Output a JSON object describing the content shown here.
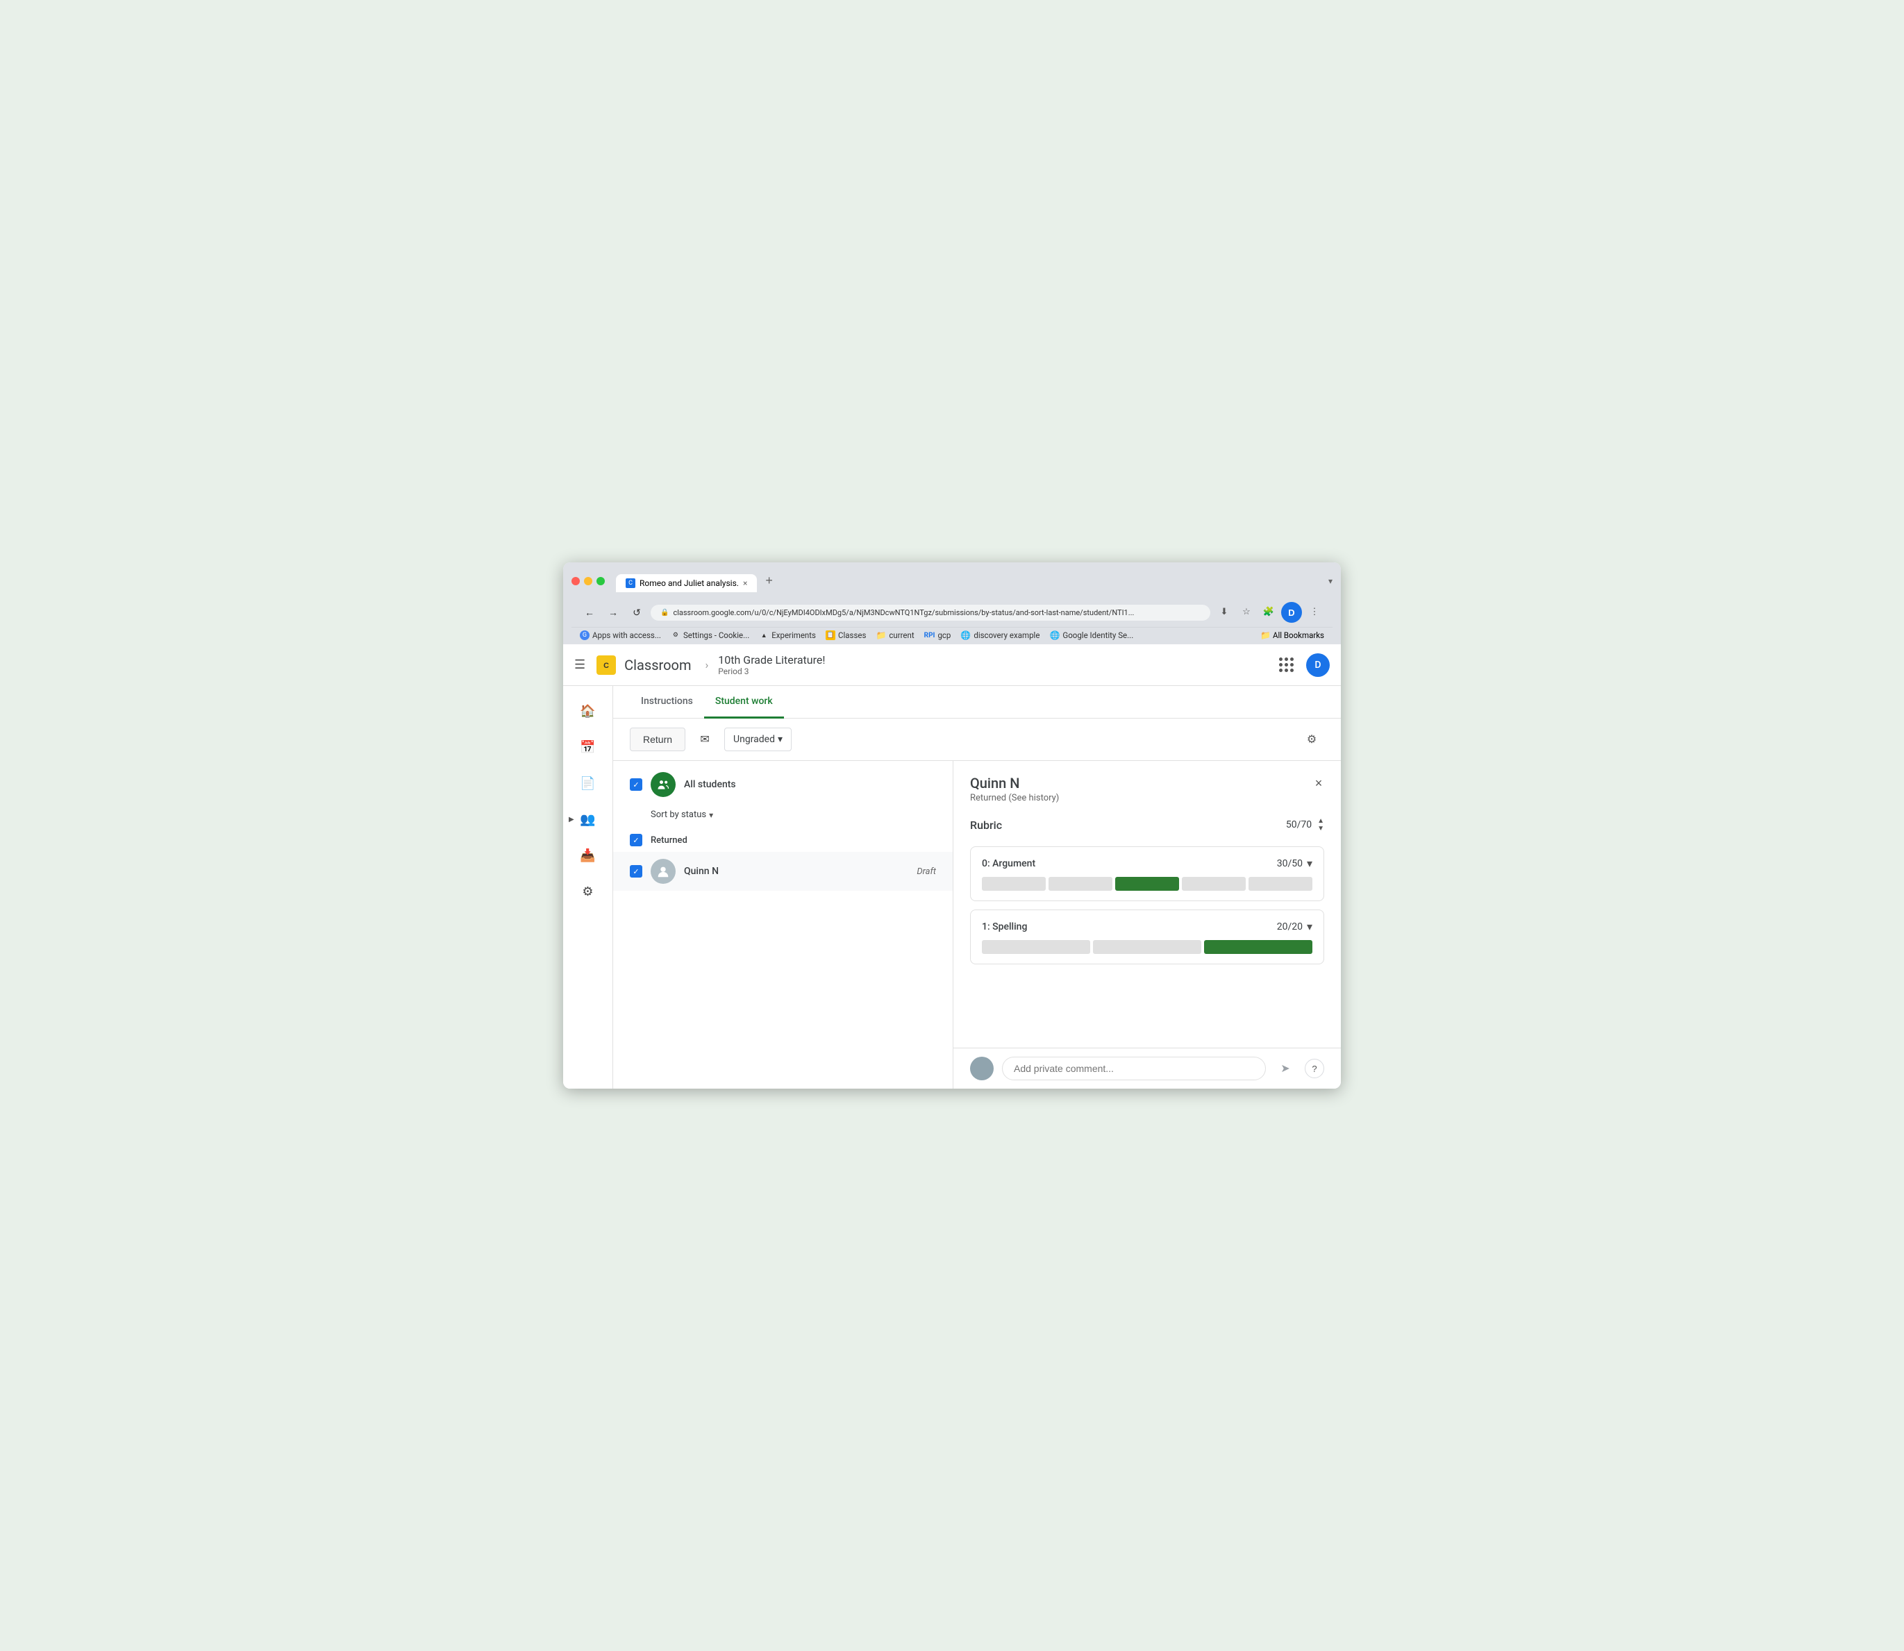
{
  "browser": {
    "tab_title": "Romeo and Juliet analysis.",
    "tab_close": "×",
    "new_tab": "+",
    "more_icon": "▾",
    "url": "classroom.google.com/u/0/c/NjEyMDI4ODIxMDg5/a/NjM3NDcwNTQ1NTgz/submissions/by-status/and-sort-last-name/student/NTI1...",
    "nav": {
      "back": "←",
      "forward": "→",
      "refresh": "↺"
    },
    "bookmarks": [
      {
        "label": "Apps with access...",
        "icon": "G",
        "icon_bg": "#4285f4"
      },
      {
        "label": "Settings - Cookie...",
        "icon": "⚙",
        "icon_bg": "#9e9e9e"
      },
      {
        "label": "Experiments",
        "icon": "▲",
        "icon_bg": "#333"
      },
      {
        "label": "Classes",
        "icon": "📋",
        "icon_bg": "#fbbc04"
      },
      {
        "label": "current",
        "icon": "📁",
        "icon_bg": "#9e9e9e"
      },
      {
        "label": "gcp",
        "icon": "RPI",
        "icon_bg": "#1a73e8"
      },
      {
        "label": "discovery example",
        "icon": "🌐",
        "icon_bg": "#34a853"
      },
      {
        "label": "Google Identity Se...",
        "icon": "G",
        "icon_bg": "#4285f4"
      }
    ],
    "bookmarks_folder": "All Bookmarks"
  },
  "app": {
    "menu_icon": "☰",
    "logo_text": "C",
    "name": "Classroom",
    "breadcrumb_sep": "›",
    "course": {
      "title": "10th Grade Literature!",
      "period": "Period 3"
    },
    "topbar_grid": "grid",
    "topbar_avatar": "D"
  },
  "sidebar": {
    "items": [
      {
        "name": "home",
        "icon": "⌂"
      },
      {
        "name": "calendar",
        "icon": "📅"
      },
      {
        "name": "assignments",
        "icon": "📄"
      },
      {
        "name": "people",
        "icon": "👥"
      },
      {
        "name": "archive",
        "icon": "📥"
      },
      {
        "name": "settings",
        "icon": "⚙"
      }
    ]
  },
  "tabs": [
    {
      "label": "Instructions",
      "active": false
    },
    {
      "label": "Student work",
      "active": true
    }
  ],
  "toolbar": {
    "return_label": "Return",
    "email_icon": "✉",
    "ungraded_label": "Ungraded",
    "dropdown_arrow": "▾",
    "gear_icon": "⚙"
  },
  "student_list": {
    "all_students_label": "All students",
    "sort_label": "Sort by status",
    "sort_arrow": "▾",
    "sections": [
      {
        "title": "Returned",
        "students": [
          {
            "name": "Quinn N",
            "status": "Draft",
            "selected": true
          }
        ]
      }
    ]
  },
  "detail": {
    "student_name": "Quinn N",
    "student_status": "Returned (See history)",
    "close_icon": "×",
    "rubric": {
      "title": "Rubric",
      "total_score": "50/70",
      "stepper_up": "▲",
      "stepper_down": "▼",
      "items": [
        {
          "name": "0: Argument",
          "score": "30/50",
          "expand_icon": "▾",
          "bar_segments": 5,
          "selected_segment": 2
        },
        {
          "name": "1: Spelling",
          "score": "20/20",
          "expand_icon": "▾",
          "bar_segments": 3,
          "selected_segment": 2
        }
      ]
    },
    "comment": {
      "placeholder": "Add private comment...",
      "send_icon": "➤",
      "help_icon": "?"
    }
  }
}
